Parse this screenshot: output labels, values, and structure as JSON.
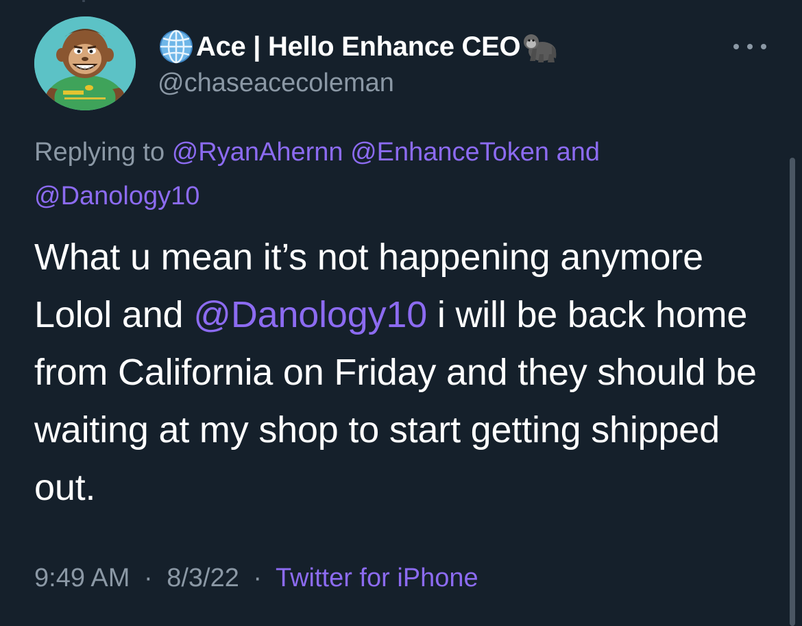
{
  "tweet": {
    "author": {
      "display_name": "Ace | Hello Enhance CEO",
      "handle": "@chaseacecoleman",
      "avatar_icon": "ape-cartoon-avatar",
      "name_prefix_icon": "globe-icon",
      "name_suffix_icon": "gorilla-icon"
    },
    "replying": {
      "prefix": "Replying to",
      "mentions": [
        "@RyanAhernn",
        "@EnhanceToken"
      ],
      "connector": "and",
      "last_mention": "@Danology10"
    },
    "text": {
      "part1": "What u mean it’s not happening anymore Lolol and",
      "mention": "@Danology10",
      "part2": "i will be back home from California on Friday and they should be waiting at my shop to start getting shipped out."
    },
    "meta": {
      "time": "9:49 AM",
      "date": "8/3/22",
      "separator": "·",
      "source": "Twitter for iPhone"
    }
  },
  "colors": {
    "background": "#15202b",
    "text_primary": "#ffffff",
    "text_secondary": "#8b98a5",
    "accent": "#8c6bf1"
  }
}
